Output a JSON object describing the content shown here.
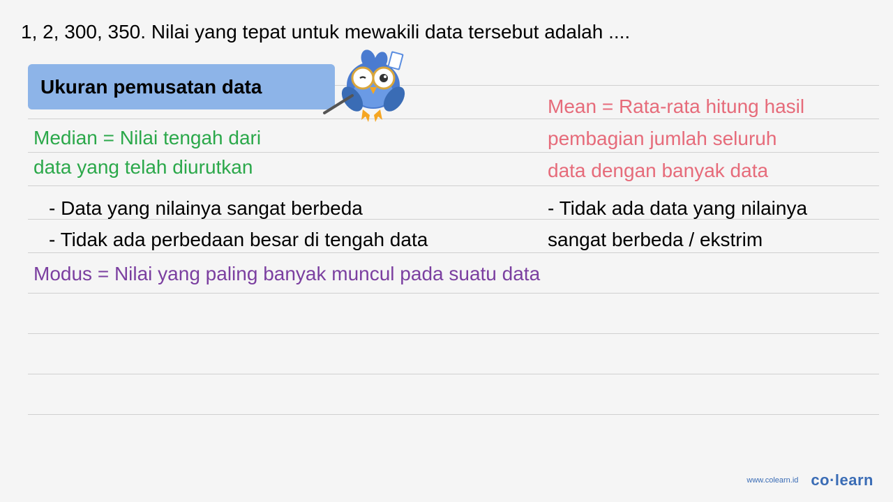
{
  "question": "1, 2, 300, 350. Nilai yang tepat untuk mewakili data tersebut adalah ....",
  "title_box": "Ukuran pemusatan data",
  "median": {
    "line1": "Median = Nilai tengah dari",
    "line2": "data yang telah diurutkan",
    "bullet1": "- Data yang nilainya sangat berbeda",
    "bullet2": "- Tidak ada perbedaan besar di tengah data"
  },
  "mean": {
    "line1": "Mean = Rata-rata hitung hasil",
    "line2": "pembagian jumlah seluruh",
    "line3": "data dengan banyak data",
    "bullet1": "- Tidak ada data yang nilainya",
    "bullet2": "sangat berbeda / ekstrim"
  },
  "modus": "Modus = Nilai yang paling banyak muncul pada suatu data",
  "footer": {
    "url": "www.colearn.id",
    "logo": "co·learn"
  },
  "colors": {
    "title_bg": "#8db4e8",
    "median": "#2ba84a",
    "mean": "#e66b7a",
    "modus": "#7b3fa0",
    "brand": "#3a6cb5"
  }
}
